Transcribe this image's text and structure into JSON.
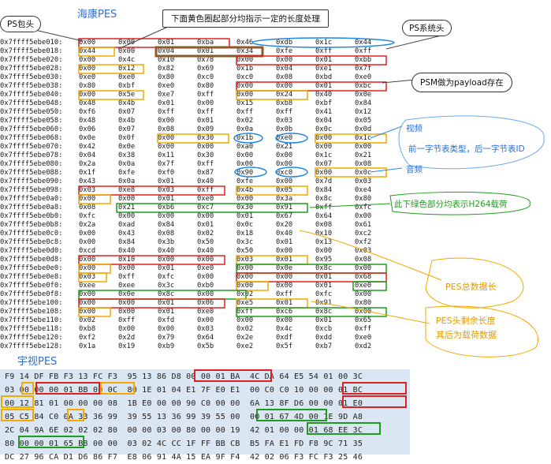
{
  "titles": {
    "hikvision": "海康PES",
    "ys": "宇视PES"
  },
  "callouts": {
    "ps_header": "PS包头",
    "yellow_note": "下面黄色圈起部分均指示一定的长度处理",
    "ps_system_header": "PS系统头",
    "psm": "PSM做为payload存在"
  },
  "notes": {
    "video": "视频",
    "stream_type_desc": "前一字节表类型，后一字节表ID",
    "audio": "音频",
    "h264": "此下绿色部分均表示H264载荷",
    "pes_total_len": "PES总数据长",
    "pes_header_remain": "PES头剩余长度",
    "payload_after": "其后为载荷数据"
  },
  "colors": {
    "red": "#e02020",
    "orange": "#f2a900",
    "blue": "#1e88e5",
    "green": "#1f9c1f",
    "brown": "#8b5a2b"
  },
  "dump": [
    {
      "addr": "0x7ffff5ebe010:",
      "bytes": [
        "0x00",
        "0x00",
        "0x01",
        "0xba",
        "0x46",
        "0xdb",
        "0x1c",
        "0x44"
      ]
    },
    {
      "addr": "0x7ffff5ebe018:",
      "bytes": [
        "0x44",
        "0x00",
        "0x04",
        "0x01",
        "0x34",
        "0xfe",
        "0xff",
        "0xff"
      ]
    },
    {
      "addr": "0x7ffff5ebe020:",
      "bytes": [
        "0x00",
        "0x4c",
        "0x10",
        "0x78",
        "0x00",
        "0x00",
        "0x01",
        "0xbb"
      ]
    },
    {
      "addr": "0x7ffff5ebe028:",
      "bytes": [
        "0x00",
        "0x12",
        "0x82",
        "0x69",
        "0x1b",
        "0x04",
        "0xe1",
        "0x7f"
      ]
    },
    {
      "addr": "0x7ffff5ebe030:",
      "bytes": [
        "0xe0",
        "0xe0",
        "0x80",
        "0xc0",
        "0xc0",
        "0x08",
        "0xbd",
        "0xe0"
      ]
    },
    {
      "addr": "0x7ffff5ebe038:",
      "bytes": [
        "0x80",
        "0xbf",
        "0xe0",
        "0x80",
        "0x00",
        "0x00",
        "0x01",
        "0xbc"
      ]
    },
    {
      "addr": "0x7ffff5ebe040:",
      "bytes": [
        "0x00",
        "0x5e",
        "0xe7",
        "0xff",
        "0x00",
        "0x24",
        "0x40",
        "0x0e"
      ]
    },
    {
      "addr": "0x7ffff5ebe048:",
      "bytes": [
        "0x48",
        "0x4b",
        "0x01",
        "0x00",
        "0x15",
        "0xb8",
        "0xbf",
        "0x84"
      ]
    },
    {
      "addr": "0x7ffff5ebe050:",
      "bytes": [
        "0xf6",
        "0x07",
        "0xff",
        "0xff",
        "0xff",
        "0xff",
        "0x41",
        "0x12"
      ]
    },
    {
      "addr": "0x7ffff5ebe058:",
      "bytes": [
        "0x48",
        "0x4b",
        "0x00",
        "0x01",
        "0x02",
        "0x03",
        "0x04",
        "0x05"
      ]
    },
    {
      "addr": "0x7ffff5ebe060:",
      "bytes": [
        "0x06",
        "0x07",
        "0x08",
        "0x09",
        "0x0a",
        "0x0b",
        "0x0c",
        "0x0d"
      ]
    },
    {
      "addr": "0x7ffff5ebe068:",
      "bytes": [
        "0x0e",
        "0x0f",
        "0x00",
        "0x30",
        "0x1b",
        "0xe0",
        "0x00",
        "0x1c"
      ]
    },
    {
      "addr": "0x7ffff5ebe070:",
      "bytes": [
        "0x42",
        "0x0e",
        "0x00",
        "0x00",
        "0xa0",
        "0x21",
        "0x00",
        "0x00"
      ]
    },
    {
      "addr": "0x7ffff5ebe078:",
      "bytes": [
        "0x04",
        "0x38",
        "0x11",
        "0x30",
        "0x00",
        "0x00",
        "0x1c",
        "0x21"
      ]
    },
    {
      "addr": "0x7ffff5ebe080:",
      "bytes": [
        "0x2a",
        "0x0a",
        "0x7f",
        "0xff",
        "0x00",
        "0x00",
        "0x07",
        "0x08"
      ]
    },
    {
      "addr": "0x7ffff5ebe088:",
      "bytes": [
        "0x1f",
        "0xfe",
        "0xf0",
        "0x87",
        "0x90",
        "0xc0",
        "0x00",
        "0x0c"
      ]
    },
    {
      "addr": "0x7ffff5ebe090:",
      "bytes": [
        "0x43",
        "0x0a",
        "0x01",
        "0x40",
        "0xfe",
        "0x00",
        "0x7d",
        "0x03"
      ]
    },
    {
      "addr": "0x7ffff5ebe098:",
      "bytes": [
        "0x03",
        "0xe8",
        "0x03",
        "0xff",
        "0x4b",
        "0x05",
        "0x84",
        "0xe4"
      ]
    },
    {
      "addr": "0x7ffff5ebe0a0:",
      "bytes": [
        "0x00",
        "0x00",
        "0x01",
        "0xe0",
        "0x00",
        "0x3a",
        "0x8c",
        "0x80"
      ]
    },
    {
      "addr": "0x7ffff5ebe0a8:",
      "bytes": [
        "0x08",
        "0x21",
        "0xb6",
        "0xc7",
        "0x30",
        "0x91",
        "0xff",
        "0xfc"
      ]
    },
    {
      "addr": "0x7ffff5ebe0b0:",
      "bytes": [
        "0xfc",
        "0x00",
        "0x00",
        "0x00",
        "0x01",
        "0x67",
        "0x64",
        "0x00"
      ]
    },
    {
      "addr": "0x7ffff5ebe0b8:",
      "bytes": [
        "0x2a",
        "0xad",
        "0x84",
        "0x01",
        "0x0c",
        "0x20",
        "0x08",
        "0x61"
      ]
    },
    {
      "addr": "0x7ffff5ebe0c0:",
      "bytes": [
        "0x00",
        "0x43",
        "0x08",
        "0x02",
        "0x18",
        "0x40",
        "0x10",
        "0xc2"
      ]
    },
    {
      "addr": "0x7ffff5ebe0c8:",
      "bytes": [
        "0x00",
        "0x84",
        "0x3b",
        "0x50",
        "0x3c",
        "0x01",
        "0x13",
        "0xf2"
      ]
    },
    {
      "addr": "0x7ffff5ebe0d0:",
      "bytes": [
        "0xcd",
        "0x40",
        "0x40",
        "0x40",
        "0x50",
        "0x00",
        "0x00",
        "0x03"
      ]
    },
    {
      "addr": "0x7ffff5ebe0d8:",
      "bytes": [
        "0x00",
        "0x10",
        "0x00",
        "0x00",
        "0x03",
        "0x01",
        "0x95",
        "0x08"
      ]
    },
    {
      "addr": "0x7ffff5ebe0e0:",
      "bytes": [
        "0x00",
        "0x00",
        "0x01",
        "0xe0",
        "0x00",
        "0x0e",
        "0x8c",
        "0x00"
      ]
    },
    {
      "addr": "0x7ffff5ebe0e8:",
      "bytes": [
        "0x03",
        "0xff",
        "0xfc",
        "0x00",
        "0x00",
        "0x00",
        "0x01",
        "0x68"
      ]
    },
    {
      "addr": "0x7ffff5ebe0f0:",
      "bytes": [
        "0xee",
        "0xee",
        "0x3c",
        "0xb0",
        "0x00",
        "0x00",
        "0x01",
        "0xe0"
      ]
    },
    {
      "addr": "0x7ffff5ebe0f8:",
      "bytes": [
        "0x00",
        "0x0e",
        "0x8c",
        "0x00",
        "0x02",
        "0xff",
        "0xfc",
        "0x00"
      ]
    },
    {
      "addr": "0x7ffff5ebe100:",
      "bytes": [
        "0x00",
        "0x00",
        "0x01",
        "0x06",
        "0xe5",
        "0x01",
        "0x91",
        "0x80"
      ]
    },
    {
      "addr": "0x7ffff5ebe108:",
      "bytes": [
        "0x00",
        "0x00",
        "0x01",
        "0xe0",
        "0xff",
        "0xc6",
        "0x8c",
        "0x00"
      ]
    },
    {
      "addr": "0x7ffff5ebe110:",
      "bytes": [
        "0x02",
        "0xff",
        "0xfd",
        "0x00",
        "0x00",
        "0x00",
        "0x01",
        "0x65"
      ]
    },
    {
      "addr": "0x7ffff5ebe118:",
      "bytes": [
        "0xb8",
        "0x00",
        "0x00",
        "0x03",
        "0x02",
        "0x4c",
        "0xcb",
        "0xff"
      ]
    },
    {
      "addr": "0x7ffff5ebe120:",
      "bytes": [
        "0xf2",
        "0x2d",
        "0x79",
        "0x64",
        "0x2e",
        "0xdf",
        "0xdd",
        "0xe0"
      ]
    },
    {
      "addr": "0x7ffff5ebe128:",
      "bytes": [
        "0x1a",
        "0x19",
        "0xb9",
        "0x5b",
        "0xe2",
        "0x5f",
        "0xb7",
        "0xd2"
      ]
    }
  ],
  "ys_rows": [
    "F9 14 DF FB F3 13 FC F3  95 13 86 D8 00 00 01 BA  4C DA 64 E5 54 01 00 3C",
    "03 00 00 00 01 BB 00 0C  80 1E 01 04 E1 7F E0 E1  00 C0 C0 10 00 00 01 BC",
    "00 12 81 01 00 00 00 08  1B E0 00 00 90 C0 00 00  6A 13 8F D6 00 00 01 E0",
    "05 C5 84 C0 0A 33 36 99  39 55 13 36 99 39 55 00  00 01 67 4D 00 1E 9D A8",
    "2C 04 9A 6E 02 02 02 80  00 00 03 00 80 00 00 19  42 01 00 00 01 68 EE 3C",
    "80 00 00 01 65 B8 00 00  03 02 4C CC 1F FF BB CB  B5 FA E1 FD F8 9C 71 35",
    "DC 27 96 CA D1 D6 86 F7  E8 06 91 4A 15 EA 9F F4  42 02 06 F3 FC F3 25 46"
  ]
}
